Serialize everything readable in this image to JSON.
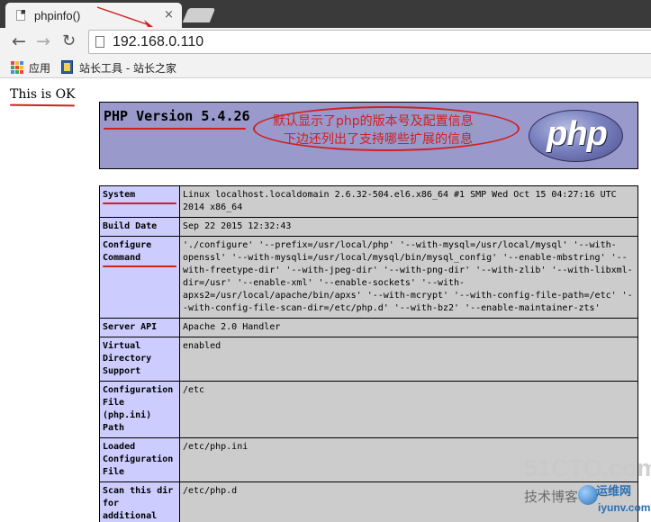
{
  "browser": {
    "tab_title": "phpinfo()",
    "tab_close": "×",
    "url": "192.168.0.110",
    "nav": {
      "back": "←",
      "forward": "→",
      "reload": "↻"
    },
    "bookmarks": [
      {
        "label": "应用",
        "icon": "apps-grid-icon"
      },
      {
        "label": "站长工具 - 站长之家",
        "icon": "site-favicon-icon"
      }
    ]
  },
  "page": {
    "ok_text": "This is OK",
    "php_version": "PHP Version 5.4.26",
    "annotation": {
      "line1": "默认显示了php的版本号及配置信息",
      "line2": "下边还列出了支持哪些扩展的信息"
    },
    "logo_text": "php",
    "table": [
      {
        "key": "System",
        "value": "Linux localhost.localdomain 2.6.32-504.el6.x86_64 #1 SMP Wed Oct 15 04:27:16 UTC 2014 x86_64",
        "marked": true
      },
      {
        "key": "Build Date",
        "value": "Sep 22 2015 12:32:43",
        "marked": false
      },
      {
        "key": "Configure Command",
        "value": "'./configure' '--prefix=/usr/local/php' '--with-mysql=/usr/local/mysql' '--with-openssl' '--with-mysqli=/usr/local/mysql/bin/mysql_config' '--enable-mbstring' '--with-freetype-dir' '--with-jpeg-dir' '--with-png-dir' '--with-zlib' '--with-libxml-dir=/usr' '--enable-xml' '--enable-sockets' '--with-apxs2=/usr/local/apache/bin/apxs' '--with-mcrypt' '--with-config-file-path=/etc' '--with-config-file-scan-dir=/etc/php.d' '--with-bz2' '--enable-maintainer-zts'",
        "marked": true
      },
      {
        "key": "Server API",
        "value": "Apache 2.0 Handler",
        "marked": false
      },
      {
        "key": "Virtual Directory Support",
        "value": "enabled",
        "marked": false
      },
      {
        "key": "Configuration File (php.ini) Path",
        "value": "/etc",
        "marked": false
      },
      {
        "key": "Loaded Configuration File",
        "value": "/etc/php.ini",
        "marked": false
      },
      {
        "key": "Scan this dir for additional .ini files",
        "value": "/etc/php.d",
        "marked": false
      }
    ]
  },
  "watermark": {
    "line1": "51CTO.com",
    "line2": "技术博客",
    "line3": "运维网",
    "line4": "iyunv.com"
  },
  "colors": {
    "header_bg": "#9999cc",
    "key_bg": "#ccccff",
    "value_bg": "#cccccc",
    "annotation_red": "#d02020"
  }
}
